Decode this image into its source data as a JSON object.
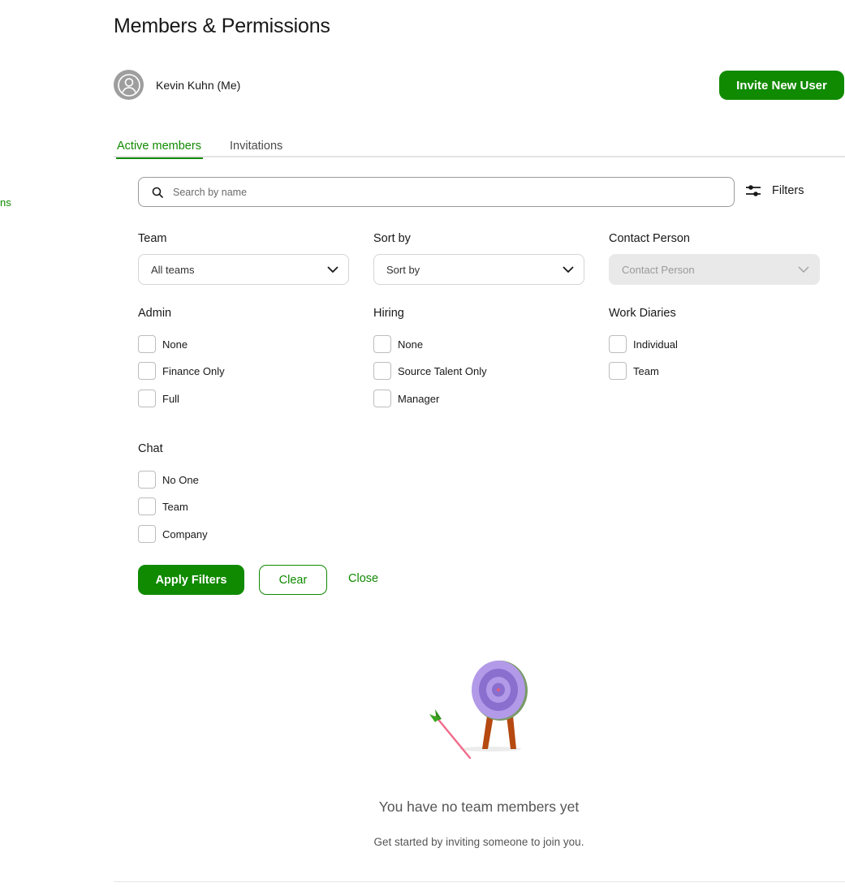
{
  "sidebar": {
    "fragment_label": "ns"
  },
  "page": {
    "title": "Members & Permissions"
  },
  "user": {
    "name": "Kevin Kuhn (Me)",
    "avatar_icon": "user-avatar-icon"
  },
  "header": {
    "invite_label": "Invite New User"
  },
  "tabs": [
    {
      "label": "Active members",
      "active": true
    },
    {
      "label": "Invitations",
      "active": false
    }
  ],
  "search": {
    "placeholder": "Search by name",
    "value": ""
  },
  "filters": {
    "toggle_label": "Filters",
    "team": {
      "label": "Team",
      "value": "All teams"
    },
    "sort": {
      "label": "Sort by",
      "value": "Sort by"
    },
    "contact": {
      "label": "Contact Person",
      "value": "Contact Person",
      "disabled": true
    },
    "admin": {
      "label": "Admin",
      "options": [
        "None",
        "Finance Only",
        "Full"
      ]
    },
    "hiring": {
      "label": "Hiring",
      "options": [
        "None",
        "Source Talent Only",
        "Manager"
      ]
    },
    "work_diaries": {
      "label": "Work Diaries",
      "options": [
        "Individual",
        "Team"
      ]
    },
    "chat": {
      "label": "Chat",
      "options": [
        "No One",
        "Team",
        "Company"
      ]
    },
    "apply_label": "Apply Filters",
    "clear_label": "Clear",
    "close_label": "Close"
  },
  "empty_state": {
    "title": "You have no team members yet",
    "subtitle": "Get started by inviting someone to join you."
  },
  "colors": {
    "brand": "#108a00",
    "target_purple": "#a78be0",
    "arrow_pink": "#f06b8a",
    "leg_brown": "#b5490f"
  }
}
